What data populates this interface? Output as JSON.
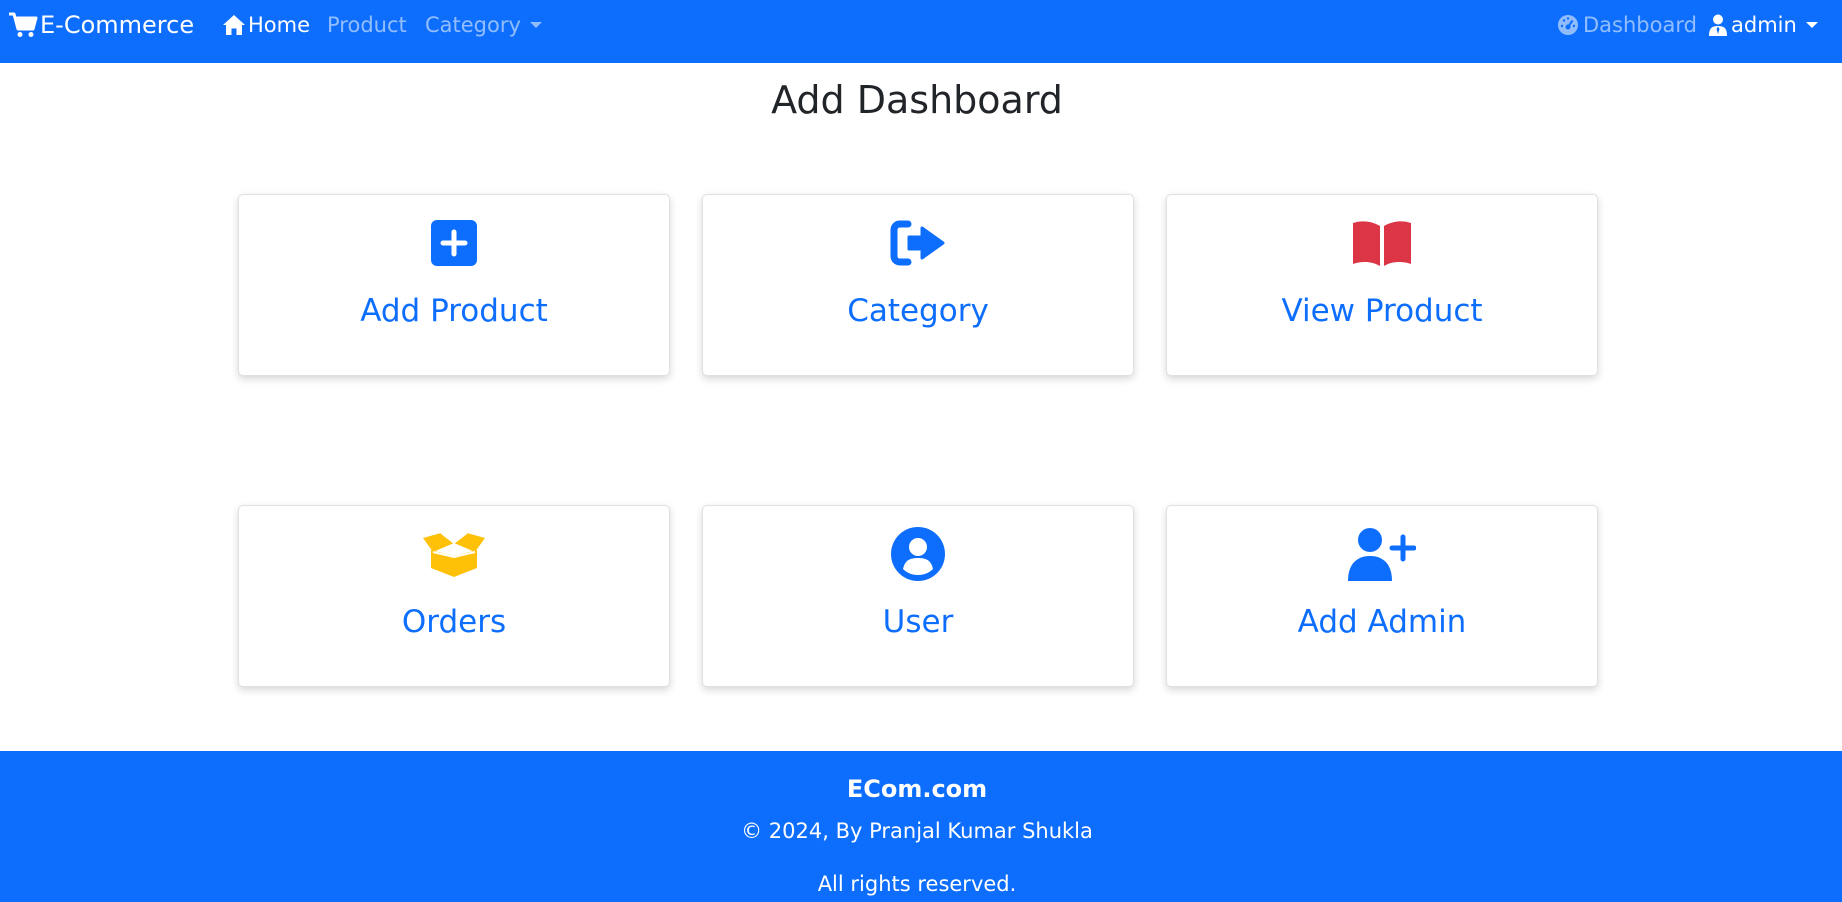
{
  "navbar": {
    "brand": "E-Commerce",
    "home": "Home",
    "product": "Product",
    "category": "Category",
    "dashboard": "Dashboard",
    "admin": "admin",
    "background_color": "#0d6efd"
  },
  "page_title": "Add Dashboard",
  "cards": [
    {
      "label": "Add Product",
      "icon": "plus-square-icon",
      "icon_color": "#0d6efd"
    },
    {
      "label": "Category",
      "icon": "sign-out-icon",
      "icon_color": "#0d6efd"
    },
    {
      "label": "View Product",
      "icon": "open-book-icon",
      "icon_color": "#dc3545"
    },
    {
      "label": "Orders",
      "icon": "open-box-icon",
      "icon_color": "#ffc107"
    },
    {
      "label": "User",
      "icon": "user-circle-icon",
      "icon_color": "#0d6efd"
    },
    {
      "label": "Add Admin",
      "icon": "user-plus-icon",
      "icon_color": "#0d6efd"
    }
  ],
  "footer": {
    "site": "ECom.com",
    "copyright": "© 2024, By Pranjal Kumar Shukla",
    "rights": "All rights reserved."
  }
}
